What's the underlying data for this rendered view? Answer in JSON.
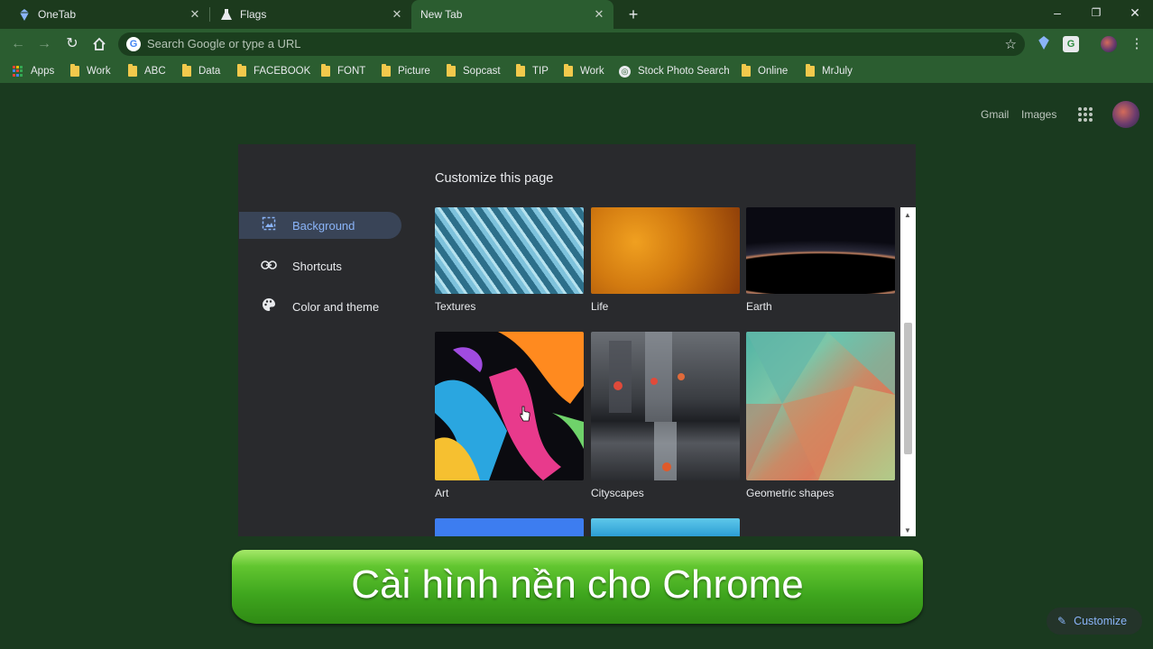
{
  "tabs": [
    {
      "title": "OneTab",
      "icon": "onetab-icon"
    },
    {
      "title": "Flags",
      "icon": "flask-icon"
    },
    {
      "title": "New Tab",
      "icon": "",
      "active": true
    }
  ],
  "omnibox": {
    "placeholder": "Search Google or type a URL"
  },
  "bookmarks": [
    "Apps",
    "Work",
    "ABC",
    "Data",
    "FACEBOOK",
    "FONT",
    "Picture",
    "Sopcast",
    "TIP",
    "Work",
    "Stock Photo Search",
    "Online",
    "MrJuly"
  ],
  "ntp": {
    "gmail": "Gmail",
    "images": "Images"
  },
  "customize_dialog": {
    "title": "Customize this page",
    "sidebar": [
      {
        "label": "Background",
        "icon": "image-icon",
        "selected": true
      },
      {
        "label": "Shortcuts",
        "icon": "link-icon"
      },
      {
        "label": "Color and theme",
        "icon": "palette-icon"
      }
    ],
    "collections": [
      {
        "label": "Textures"
      },
      {
        "label": "Life"
      },
      {
        "label": "Earth"
      },
      {
        "label": "Art"
      },
      {
        "label": "Cityscapes"
      },
      {
        "label": "Geometric shapes"
      }
    ]
  },
  "banner": {
    "text": "Cài hình nền cho Chrome"
  },
  "customize_button": {
    "label": "Customize"
  }
}
